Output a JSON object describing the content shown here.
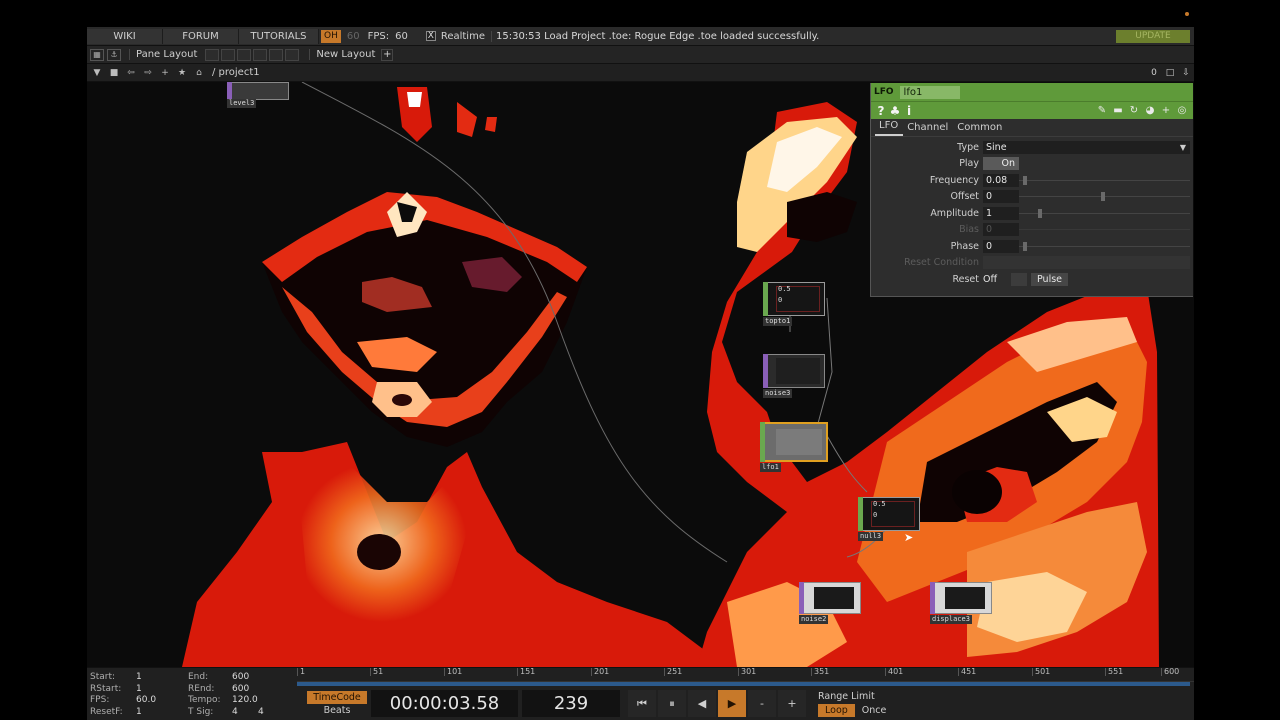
{
  "menu": {
    "wiki": "WIKI",
    "forum": "FORUM",
    "tutorials": "TUTORIALS",
    "oh": "OH",
    "dim_60": "60",
    "fps_label": "FPS:",
    "fps_value": "60",
    "realtime_check": "X",
    "realtime_label": "Realtime",
    "status_message": "15:30:53 Load Project .toe: Rogue Edge .toe loaded successfully.",
    "update": "UPDATE"
  },
  "panebar": {
    "pane_layout": "Pane Layout",
    "new_layout": "New Layout",
    "plus": "+"
  },
  "pathbar": {
    "path": "/ project1",
    "counter": "0"
  },
  "nodes": {
    "level3": "level3",
    "topto1": "topto1",
    "noise3": "noise3",
    "lfo1": "lfo1",
    "null3": "null3",
    "noise2": "noise2",
    "displace3": "displace3",
    "readout_top": "0.5",
    "readout_bottom": "0"
  },
  "param_panel": {
    "op_type": "LFO",
    "op_name": "lfo1",
    "tabs": [
      "LFO",
      "Channel",
      "Common"
    ],
    "params": {
      "type_label": "Type",
      "type_value": "Sine",
      "play_label": "Play",
      "play_value": "On",
      "frequency_label": "Frequency",
      "frequency_value": "0.08",
      "offset_label": "Offset",
      "offset_value": "0",
      "amplitude_label": "Amplitude",
      "amplitude_value": "1",
      "bias_label": "Bias",
      "bias_value": "0",
      "phase_label": "Phase",
      "phase_value": "0",
      "reset_condition_label": "Reset Condition",
      "reset_label": "Reset",
      "reset_value": "Off",
      "pulse_label": "Pulse"
    }
  },
  "timeline": {
    "stats": {
      "start_k": "Start:",
      "start_v": "1",
      "end_k": "End:",
      "end_v": "600",
      "rstart_k": "RStart:",
      "rstart_v": "1",
      "rend_k": "REnd:",
      "rend_v": "600",
      "fps_k": "FPS:",
      "fps_v": "60.0",
      "tempo_k": "Tempo:",
      "tempo_v": "120.0",
      "resetf_k": "ResetF:",
      "resetf_v": "1",
      "tsig_k": "T Sig:",
      "tsig_v1": "4",
      "tsig_v2": "4"
    },
    "ruler_ticks": [
      "1",
      "51",
      "101",
      "151",
      "201",
      "251",
      "301",
      "351",
      "401",
      "451",
      "501",
      "551",
      "600"
    ],
    "timecode_label": "TimeCode",
    "beats_label": "Beats",
    "time_display": "00:00:03.58",
    "frame_display": "239",
    "range_limit_label": "Range Limit",
    "loop_label": "Loop",
    "once_label": "Once",
    "minus": "-",
    "plus": "+"
  },
  "colors": {
    "accent_orange": "#c7792a",
    "lfo_green": "#5f9a3a",
    "update_green": "#6c7f2d",
    "fire_red": "#d81a0a",
    "fire_orange": "#f06a1c",
    "fire_yellow": "#ffd58a"
  }
}
